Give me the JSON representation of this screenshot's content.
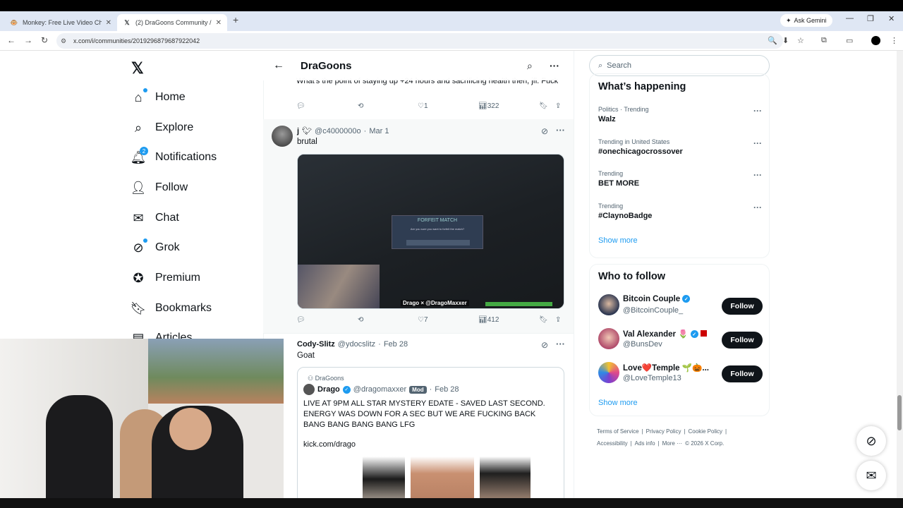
{
  "browser": {
    "tabs": [
      {
        "title": "Monkey: Free Live Video Chat ·",
        "active": false
      },
      {
        "title": "(2) DraGoons Community / X",
        "active": true
      }
    ],
    "gemini_label": "Ask Gemini",
    "url": "x.com/i/communities/2019296879687922042"
  },
  "nav": {
    "logo": "𝕏",
    "items": [
      {
        "label": "Home",
        "icon": "home-icon"
      },
      {
        "label": "Explore",
        "icon": "search-icon"
      },
      {
        "label": "Notifications",
        "icon": "bell-icon",
        "badge": "2"
      },
      {
        "label": "Follow",
        "icon": "person-plus-icon"
      },
      {
        "label": "Chat",
        "icon": "mail-icon"
      },
      {
        "label": "Grok",
        "icon": "grok-icon"
      },
      {
        "label": "Premium",
        "icon": "verified-icon"
      },
      {
        "label": "Bookmarks",
        "icon": "bookmark-icon"
      },
      {
        "label": "Articles",
        "icon": "article-icon"
      }
    ]
  },
  "header": {
    "title": "DraGoons"
  },
  "prev_post": {
    "text": "What's the point of staying up +24 hours and sacrificing health then, jfl. Fuck",
    "likes": "1",
    "views": "322"
  },
  "post1": {
    "name": "j",
    "handle": "@c4000000o",
    "date": "Mar 1",
    "text": "brutal",
    "media_dialog_title": "FORFEIT MATCH",
    "media_dialog_question": "Are you sure you want to forfeit the match?",
    "media_brand": "Drago × @DragoMaxxer",
    "likes": "7",
    "views": "412"
  },
  "post2": {
    "name": "Cody-Slitz",
    "handle": "@ydocslitz",
    "date": "Feb 28",
    "text": "Goat",
    "quote": {
      "community": "DraGoons",
      "name": "Drago",
      "handle": "@dragomaxxer",
      "mod": "Mod",
      "date": "Feb 28",
      "text": "LIVE AT 9PM ALL STAR MYSTERY EDATE - SAVED LAST SECOND. ENERGY WAS DOWN FOR A SEC BUT WE ARE FUCKING BACK BANG BANG BANG BANG LFG",
      "link": "kick.com/drago"
    }
  },
  "sidebar": {
    "search_placeholder": "Search",
    "happening_title": "What’s happening",
    "trends": [
      {
        "context": "Politics · Trending",
        "name": "Walz"
      },
      {
        "context": "Trending in United States",
        "name": "#onechicagocrossover"
      },
      {
        "context": "Trending",
        "name": "BET MORE"
      },
      {
        "context": "Trending",
        "name": "#ClaynoBadge"
      }
    ],
    "show_more": "Show more",
    "who_title": "Who to follow",
    "follow": [
      {
        "name": "Bitcoin Couple",
        "handle": "@BitcoinCouple_",
        "button": "Follow",
        "color": "#2a3550"
      },
      {
        "name": "Val Alexander 🌷",
        "handle": "@BunsDev",
        "button": "Follow",
        "color": "#b04a6a"
      },
      {
        "name": "Love❤️Temple 🌱🎃...",
        "handle": "@LoveTemple13",
        "button": "Follow",
        "color": "#7a3fd0"
      }
    ],
    "show_more2": "Show more",
    "footer": {
      "row1": [
        "Terms of Service",
        "|",
        "Privacy Policy",
        "|",
        "Cookie Policy",
        "|"
      ],
      "row2": [
        "Accessibility",
        "|",
        "Ads info",
        "|",
        "More ···",
        "© 2026 X Corp."
      ]
    }
  }
}
